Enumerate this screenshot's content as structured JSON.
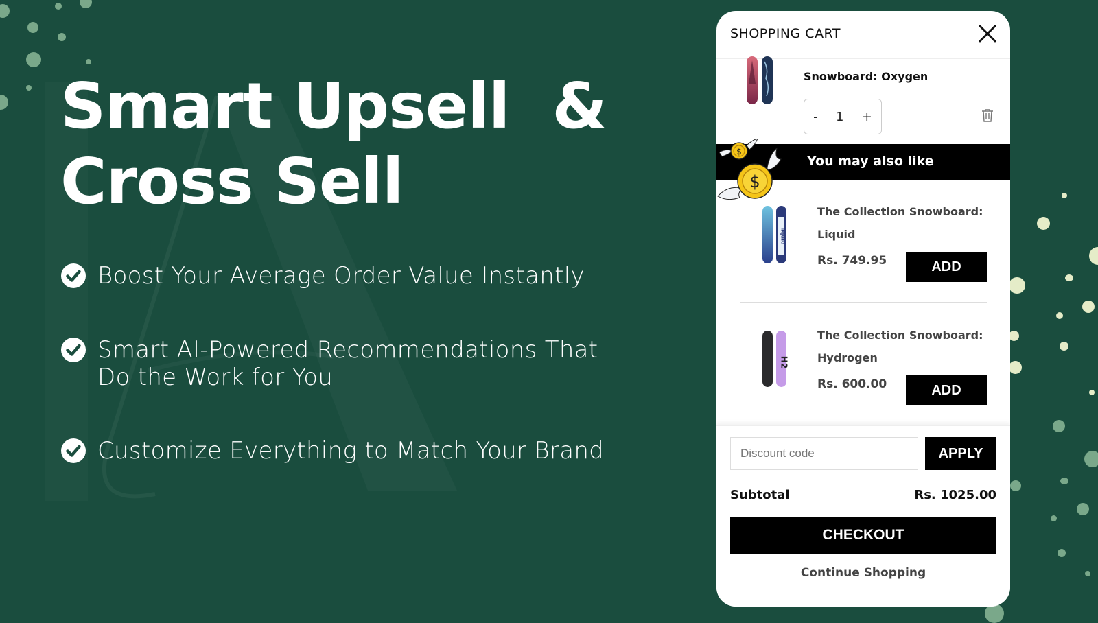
{
  "colors": {
    "background": "#1a4d3e",
    "dot_green": "#7aa88a",
    "dot_cream": "#e5ecc8",
    "panel": "#ffffff",
    "button": "#000000"
  },
  "hero": {
    "title_line1": "Smart Upsell  &",
    "title_line2": "Cross Sell",
    "features": [
      {
        "icon": "check-circle-icon",
        "text_line1": "Boost Your Average Order Value Instantly",
        "text_line2": ""
      },
      {
        "icon": "check-circle-icon",
        "text_line1": "Smart AI-Powered Recommendations That",
        "text_line2": "Do the Work for You"
      },
      {
        "icon": "check-circle-icon",
        "text_line1": "Customize Everything to Match Your Brand",
        "text_line2": ""
      }
    ]
  },
  "cart": {
    "title": "SHOPPING CART",
    "close_icon": "close-icon",
    "line_item": {
      "name": "Snowboard: Oxygen",
      "quantity": "1",
      "minus_label": "-",
      "plus_label": "+",
      "delete_icon": "trash-icon"
    },
    "upsell": {
      "heading": "You may also like",
      "decoration": "flying-coins-icon",
      "items": [
        {
          "name": "The Collection Snowboard: Liquid",
          "price": "Rs. 749.95",
          "add_label": "ADD"
        },
        {
          "name": "The Collection Snowboard: Hydrogen",
          "price": "Rs. 600.00",
          "add_label": "ADD"
        }
      ]
    },
    "footer": {
      "discount_placeholder": "Discount code",
      "discount_value": "",
      "apply_label": "APPLY",
      "subtotal_label": "Subtotal",
      "subtotal_value": "Rs. 1025.00",
      "checkout_label": "CHECKOUT",
      "continue_label": "Continue Shopping"
    }
  }
}
